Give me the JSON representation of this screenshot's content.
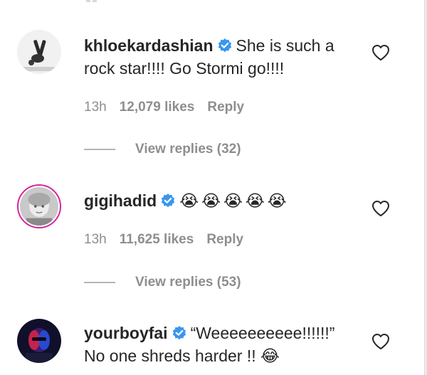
{
  "comments": [
    {
      "username": "khloekardashian",
      "text": "She is such a rock star!!!! Go Stormi go!!!!",
      "time": "13h",
      "likes": "12,079 likes",
      "reply_label": "Reply",
      "view_replies": "View replies (32)",
      "verified": true,
      "avatar_icon": "gymnast-photo-icon"
    },
    {
      "username": "gigihadid",
      "text": "",
      "emojis": [
        "😭",
        "😭",
        "😭",
        "😭",
        "😭"
      ],
      "time": "13h",
      "likes": "11,625 likes",
      "reply_label": "Reply",
      "view_replies": "View replies (53)",
      "verified": true,
      "has_story_ring": true,
      "avatar_icon": "child-photo-icon"
    },
    {
      "username": "yourboyfai",
      "text_line1": "“Weeeeeeeeee!!!!!!”",
      "text_line2": "No one shreds harder !!",
      "emoji": "😂",
      "verified": true,
      "avatar_icon": "neon-portrait-icon"
    }
  ],
  "colors": {
    "verified_blue": "#3897f0",
    "meta_gray": "#8e8e8e",
    "text_dark": "#262626"
  },
  "icons": {
    "like": "heart-outline-icon",
    "verified": "verified-badge-icon"
  }
}
